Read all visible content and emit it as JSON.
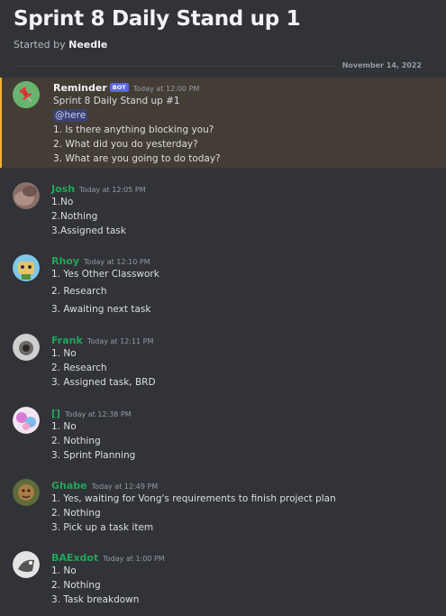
{
  "thread": {
    "title": "Sprint 8 Daily Stand up 1",
    "started_by_prefix": "Started by",
    "started_by_name": "Needle",
    "date_divider": "November 14, 2022"
  },
  "colors": {
    "background": "#313338",
    "highlight_background": "#443d35",
    "highlight_border": "#f0b232",
    "member_name": "#23a55a",
    "bot_tag": "#5865f2",
    "mention_bg": "#3c4270"
  },
  "messages": [
    {
      "author": "Reminder",
      "bot_tag": "BOT",
      "timestamp": "Today at 12:00 PM",
      "avatar_icon": "pin-icon",
      "lines": [
        "Sprint 8 Daily Stand up #1",
        "@here",
        "1. Is there anything blocking you?",
        "2. What did you do yesterday?",
        "3. What are you going to do today?"
      ]
    },
    {
      "author": "Josh",
      "timestamp": "Today at 12:05 PM",
      "lines": [
        "1.No",
        "2.Nothing",
        "3.Assigned task"
      ]
    },
    {
      "author": "Rhoy",
      "timestamp": "Today at 12:10 PM",
      "lines": [
        "1. Yes Other Classwork",
        "2. Research",
        "3. Awaiting next task"
      ]
    },
    {
      "author": "Frank",
      "timestamp": "Today at 12:11 PM",
      "lines": [
        "1. No",
        "2. Research",
        "3. Assigned task, BRD"
      ]
    },
    {
      "author": "[]",
      "timestamp": "Today at 12:38 PM",
      "lines": [
        "1. No",
        "2. Nothing",
        "3. Sprint Planning"
      ]
    },
    {
      "author": "Ghabe",
      "timestamp": "Today at 12:49 PM",
      "lines": [
        "1. Yes, waiting for Vong's requirements to finish project plan",
        "2. Nothing",
        "3. Pick up a task item"
      ]
    },
    {
      "author": "BAExdot",
      "timestamp": "Today at 1:00 PM",
      "lines": [
        "1. No",
        "2. Nothing",
        "3. Task breakdown"
      ]
    }
  ]
}
